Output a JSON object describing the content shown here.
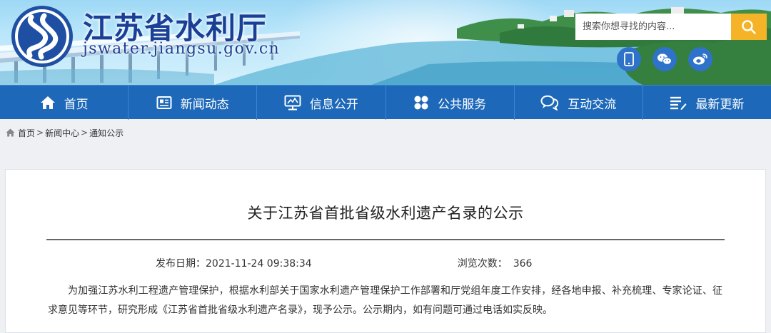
{
  "site": {
    "name": "江苏省水利厅",
    "domain": "jswater.jiangsu.gov.cn"
  },
  "search": {
    "placeholder": "搜索你想寻找的内容..."
  },
  "social_icons": [
    "mobile-icon",
    "wechat-icon",
    "weibo-icon"
  ],
  "nav": {
    "items": [
      {
        "label": "首页",
        "icon": "home-icon"
      },
      {
        "label": "新闻动态",
        "icon": "news-icon"
      },
      {
        "label": "信息公开",
        "icon": "info-disclosure-icon"
      },
      {
        "label": "公共服务",
        "icon": "services-icon"
      },
      {
        "label": "互动交流",
        "icon": "chat-icon"
      },
      {
        "label": "最新更新",
        "icon": "list-icon"
      }
    ]
  },
  "breadcrumb": {
    "items": [
      "首页",
      "新闻中心",
      "通知公示"
    ],
    "separator": ">"
  },
  "article": {
    "title": "关于江苏省首批省级水利遗产名录的公示",
    "date_label": "发布日期：",
    "date_value": "2021-11-24 09:38:34",
    "views_label": "浏览次数：",
    "views_value": "366",
    "body": "为加强江苏水利工程遗产管理保护，根据水利部关于国家水利遗产管理保护工作部署和厅党组年度工作安排，经各地申报、补充梳理、专家论证、征求意见等环节，研究形成《江苏省首批省级水利遗产名录》，现予公示。公示期内，如有问题可通过电话如实反映。"
  },
  "colors": {
    "nav_bg": "#1d68b9",
    "brand_text": "#1a3f96",
    "search_button": "#f5b427",
    "social_bg": "#2f72c9"
  }
}
